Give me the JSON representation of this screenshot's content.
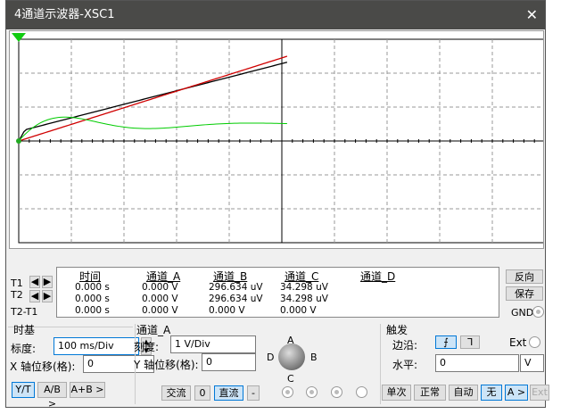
{
  "window": {
    "title": "4通道示波器-XSC1"
  },
  "readout": {
    "headers": [
      "时间",
      "通道_A",
      "通道_B",
      "通道_C",
      "通道_D"
    ],
    "rows": [
      {
        "label": "T1",
        "values": [
          "0.000 s",
          "0.000 V",
          "296.634 uV",
          "34.298 uV",
          ""
        ]
      },
      {
        "label": "T2",
        "values": [
          "0.000 s",
          "0.000 V",
          "296.634 uV",
          "34.298 uV",
          ""
        ]
      },
      {
        "label": "T2-T1",
        "values": [
          "0.000 s",
          "0.000 V",
          "0.000 V",
          "0.000 V",
          ""
        ]
      }
    ]
  },
  "side": {
    "reverse": "反向",
    "save": "保存",
    "gnd": "GND"
  },
  "timebase": {
    "title": "时基",
    "scale_label": "标度:",
    "scale": "100 ms/Div",
    "xpos_label": "X 轴位移(格):",
    "xpos": "0",
    "modes": [
      "Y/T",
      "A/B >",
      "A+B >"
    ]
  },
  "channel": {
    "title": "通道_A",
    "scale_label": "刻度:",
    "scale": "1  V/Div",
    "ypos_label": "Y 轴位移(格):",
    "ypos": "0",
    "coupling": [
      "交流",
      "0",
      "直流",
      "-"
    ],
    "knob": [
      "A",
      "B",
      "C",
      "D"
    ]
  },
  "trigger": {
    "title": "触发",
    "edge_label": "边沿:",
    "ext": "Ext",
    "level_label": "水平:",
    "level": "0",
    "unit": "V",
    "modes": [
      "单次",
      "正常",
      "自动",
      "无",
      "A >",
      "Ext"
    ]
  },
  "colors": {
    "chA": "#d00000",
    "chB": "#00cc00",
    "chC": "#000000"
  }
}
